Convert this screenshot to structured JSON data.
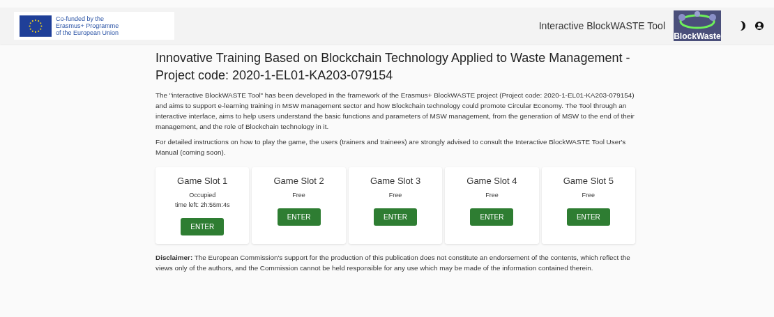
{
  "header": {
    "eu_logo_text": "Co-funded by the Erasmus+ Programme of the European Union",
    "tool_title": "Interactive BlockWASTE Tool",
    "logo_text": "BlockWaste"
  },
  "title": "Innovative Training Based on Blockchain Technology Applied to Waste Management - Project code: 2020-1-EL01-KA203-079154",
  "paragraphs": [
    "The \"interactive BlockWASTE Tool\" has been developed in the framework of the Erasmus+ BlockWASTE project (Project code: 2020-1-EL01-KA203-079154) and aims to support e-learning training in MSW management sector and how Blockchain technology could promote Circular Economy. The Tool through an interactive interface, aims to help users understand the basic functions and parameters of MSW management, from the generation of MSW to the end of their management, and the role of Blockchain technology in it.",
    "For detailed instructions on how to play the game, the users (trainers and trainees) are strongly advised to consult the Interactive BlockWASTE Tool User's Manual (coming soon)."
  ],
  "slots": [
    {
      "title": "Game Slot 1",
      "status": "Occupied",
      "time_left": "time left: 2h:56m:4s",
      "button": "ENTER"
    },
    {
      "title": "Game Slot 2",
      "status": "Free",
      "button": "ENTER"
    },
    {
      "title": "Game Slot 3",
      "status": "Free",
      "button": "ENTER"
    },
    {
      "title": "Game Slot 4",
      "status": "Free",
      "button": "ENTER"
    },
    {
      "title": "Game Slot 5",
      "status": "Free",
      "button": "ENTER"
    }
  ],
  "disclaimer": "**Disclaimer:** The European Commission's support for the production of this publication does not constitute an endorsement of the contents, which reflect the views only of the authors, and the Commission cannot be held responsible for any use which may be made of the information contained therein."
}
